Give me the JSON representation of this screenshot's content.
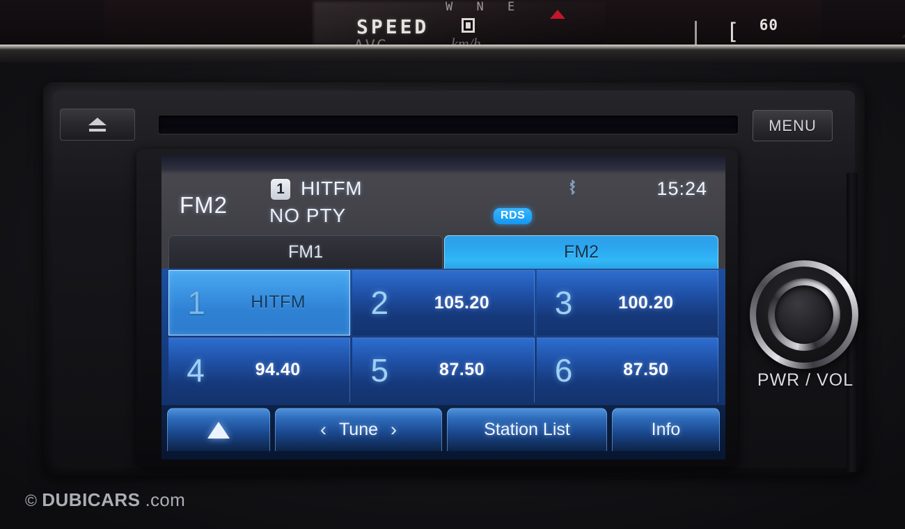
{
  "cluster": {
    "compass_marks": "W  N  E",
    "speed_label": "SPEED",
    "avg_label": "AVG",
    "kmh_label": "km/h",
    "dots": "...",
    "gauge_bracket": "[",
    "gauge_value": "60"
  },
  "headunit": {
    "eject_icon": "eject-icon",
    "menu_label": "MENU",
    "knob_label": "PWR / VOL"
  },
  "screen": {
    "reflection_text": "",
    "header": {
      "band": "FM2",
      "preset_number": "1",
      "station_name": "HITFM",
      "pty": "NO PTY",
      "rds_badge": "RDS",
      "bluetooth_icon": "bluetooth-icon",
      "clock": "15:24"
    },
    "tabs": [
      {
        "label": "FM1",
        "active": false
      },
      {
        "label": "FM2",
        "active": true
      }
    ],
    "presets": [
      {
        "number": "1",
        "value": "HITFM",
        "selected": true
      },
      {
        "number": "2",
        "value": "105.20",
        "selected": false
      },
      {
        "number": "3",
        "value": "100.20",
        "selected": false
      },
      {
        "number": "4",
        "value": "94.40",
        "selected": false
      },
      {
        "number": "5",
        "value": "87.50",
        "selected": false
      },
      {
        "number": "6",
        "value": "87.50",
        "selected": false
      }
    ],
    "soft_buttons": {
      "up": "",
      "tune": "Tune",
      "tune_prev": "‹",
      "tune_next": "›",
      "station_list": "Station List",
      "info": "Info"
    }
  },
  "watermark": {
    "copyright": "©",
    "brand": "DUBICARS",
    "tld": ".com"
  },
  "colors": {
    "accent_blue": "#2ba6ef",
    "rds_blue": "#1397f2",
    "preset_blue": "#1f4fa4",
    "selected_blue": "#3d96e4"
  }
}
